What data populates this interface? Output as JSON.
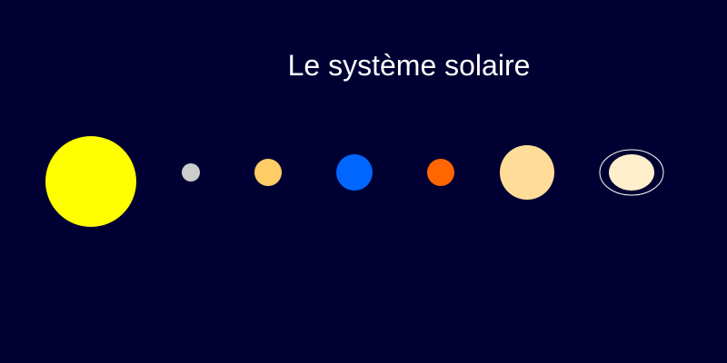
{
  "title": "Le système solaire",
  "colors": {
    "background": "#000033",
    "title": "#ffffff",
    "saturn_ring": "#ffffff"
  },
  "bodies": [
    {
      "id": "sun",
      "color": "#ffff00"
    },
    {
      "id": "mercury",
      "color": "#cccccc"
    },
    {
      "id": "venus",
      "color": "#ffcc66"
    },
    {
      "id": "earth",
      "color": "#0066ff"
    },
    {
      "id": "mars",
      "color": "#ff6600"
    },
    {
      "id": "jupiter",
      "color": "#ffdd99"
    },
    {
      "id": "saturn",
      "color": "#ffeecc",
      "ring": true
    }
  ]
}
